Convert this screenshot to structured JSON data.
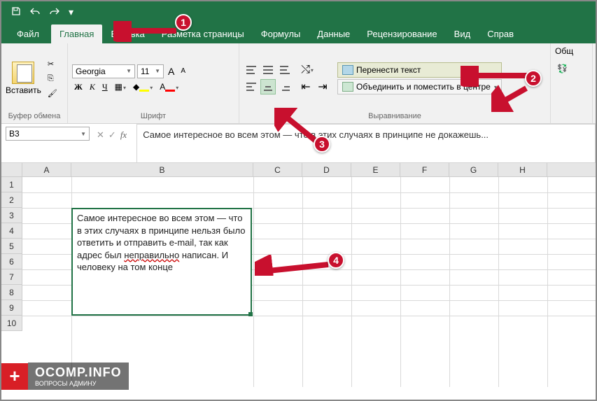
{
  "tabs": {
    "file": "Файл",
    "home": "Главная",
    "insert": "Вставка",
    "pagelayout": "Разметка страницы",
    "formulas": "Формулы",
    "data": "Данные",
    "review": "Рецензирование",
    "view": "Вид",
    "help": "Справ"
  },
  "clipboard": {
    "paste": "Вставить",
    "label": "Буфер обмена"
  },
  "font": {
    "name": "Georgia",
    "size": "11",
    "bold": "Ж",
    "italic": "К",
    "underline": "Ч",
    "label": "Шрифт",
    "incA": "A",
    "decA": "A"
  },
  "alignment": {
    "wrap": "Перенести текст",
    "merge": "Объединить и поместить в центре",
    "label": "Выравнивание"
  },
  "number": {
    "general": "Общ"
  },
  "namebox": "B3",
  "formula": "Самое интересное во всем этом — что в этих случаях в принципе не докажешь...",
  "columns": [
    "A",
    "B",
    "C",
    "D",
    "E",
    "F",
    "G",
    "H"
  ],
  "rows": [
    "1",
    "2",
    "3",
    "4",
    "5",
    "6",
    "7",
    "8",
    "9",
    "10"
  ],
  "cell_text_parts": {
    "p1": "Самое интересное во всем этом — что в этих случаях в принципе нельзя было ответить и отправить e-mail, так как адрес был ",
    "u": "неправильно",
    "p2": " написан. И человеку на том концe"
  },
  "logo": {
    "main": "OCOMP.INFO",
    "sub": "ВОПРОСЫ АДМИНУ"
  },
  "callouts": {
    "c1": "1",
    "c2": "2",
    "c3": "3",
    "c4": "4"
  }
}
